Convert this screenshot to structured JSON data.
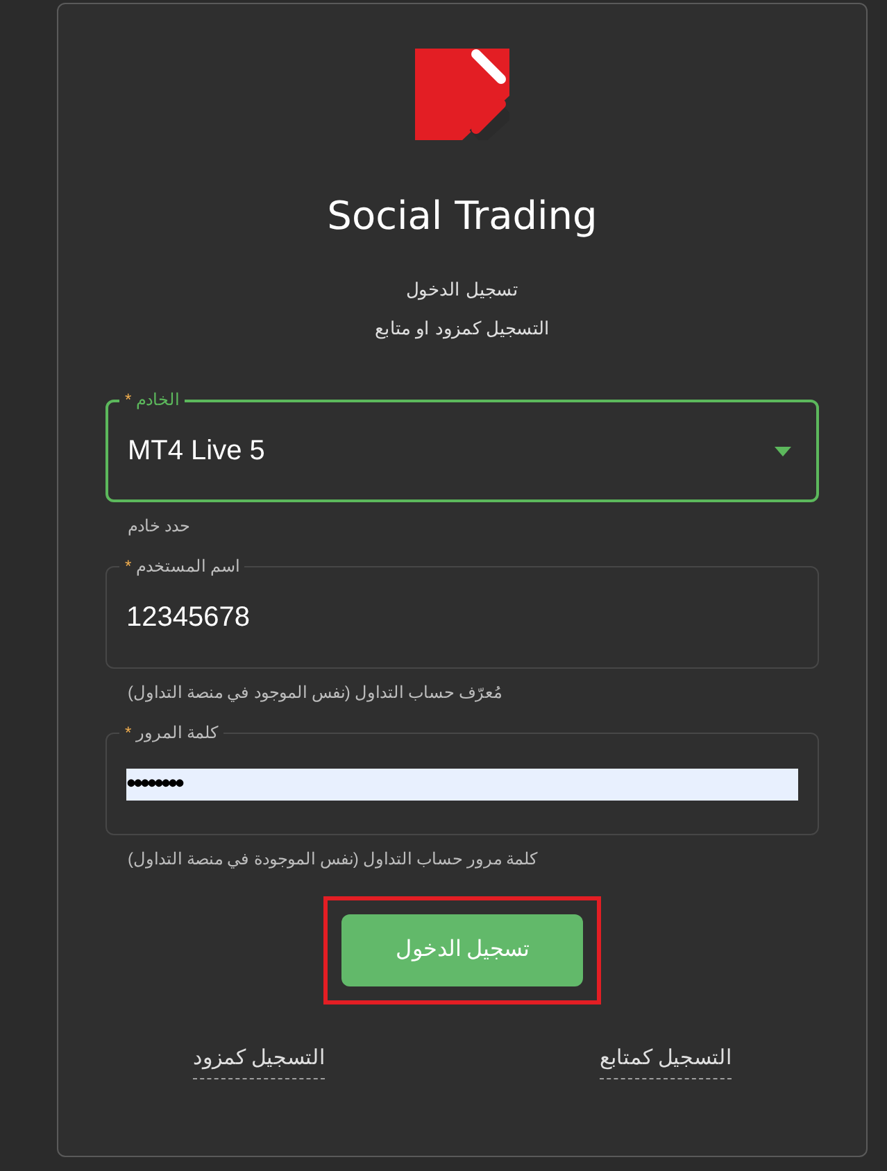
{
  "title": "Social Trading",
  "subtitle_lines": [
    "تسجيل الدخول",
    "التسجيل كمزود او متابع"
  ],
  "fields": [
    {
      "kind": "select",
      "label": "الخادم",
      "required_mark": "*",
      "value": "MT4 Live 5",
      "focused": true,
      "helper": "حدد خادم"
    },
    {
      "kind": "text",
      "label": "اسم المستخدم",
      "required_mark": "*",
      "value": "12345678",
      "focused": false,
      "helper": "مُعرّف حساب التداول (نفس الموجود في منصة التداول)"
    },
    {
      "kind": "password",
      "label": "كلمة المرور",
      "required_mark": "*",
      "value": "••••••••",
      "focused": false,
      "autofilled": true,
      "helper": "كلمة مرور حساب التداول (نفس الموجودة في منصة التداول)"
    }
  ],
  "login_button": {
    "label": "تسجيل الدخول",
    "highlighted": true
  },
  "links": [
    "التسجيل كمتابع",
    "التسجيل كمزود"
  ]
}
